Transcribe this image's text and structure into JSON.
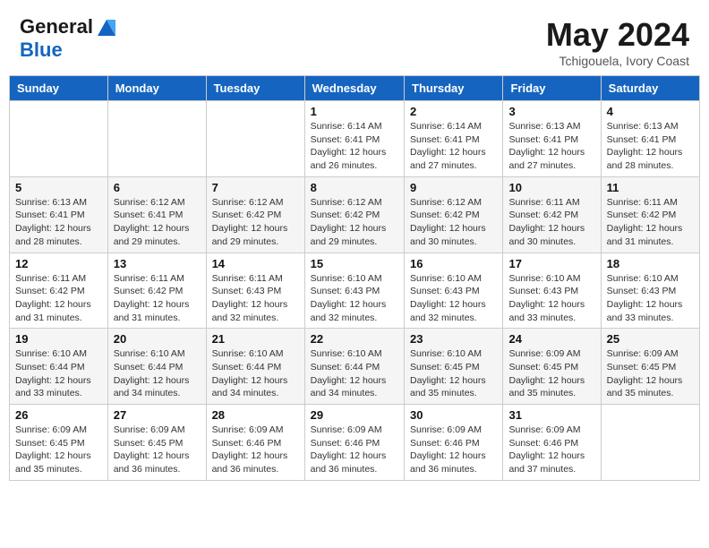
{
  "logo": {
    "line1": "General",
    "line2": "Blue"
  },
  "header": {
    "month": "May 2024",
    "location": "Tchigouela, Ivory Coast"
  },
  "weekdays": [
    "Sunday",
    "Monday",
    "Tuesday",
    "Wednesday",
    "Thursday",
    "Friday",
    "Saturday"
  ],
  "weeks": [
    [
      {
        "day": "",
        "info": ""
      },
      {
        "day": "",
        "info": ""
      },
      {
        "day": "",
        "info": ""
      },
      {
        "day": "1",
        "info": "Sunrise: 6:14 AM\nSunset: 6:41 PM\nDaylight: 12 hours\nand 26 minutes."
      },
      {
        "day": "2",
        "info": "Sunrise: 6:14 AM\nSunset: 6:41 PM\nDaylight: 12 hours\nand 27 minutes."
      },
      {
        "day": "3",
        "info": "Sunrise: 6:13 AM\nSunset: 6:41 PM\nDaylight: 12 hours\nand 27 minutes."
      },
      {
        "day": "4",
        "info": "Sunrise: 6:13 AM\nSunset: 6:41 PM\nDaylight: 12 hours\nand 28 minutes."
      }
    ],
    [
      {
        "day": "5",
        "info": "Sunrise: 6:13 AM\nSunset: 6:41 PM\nDaylight: 12 hours\nand 28 minutes."
      },
      {
        "day": "6",
        "info": "Sunrise: 6:12 AM\nSunset: 6:41 PM\nDaylight: 12 hours\nand 29 minutes."
      },
      {
        "day": "7",
        "info": "Sunrise: 6:12 AM\nSunset: 6:42 PM\nDaylight: 12 hours\nand 29 minutes."
      },
      {
        "day": "8",
        "info": "Sunrise: 6:12 AM\nSunset: 6:42 PM\nDaylight: 12 hours\nand 29 minutes."
      },
      {
        "day": "9",
        "info": "Sunrise: 6:12 AM\nSunset: 6:42 PM\nDaylight: 12 hours\nand 30 minutes."
      },
      {
        "day": "10",
        "info": "Sunrise: 6:11 AM\nSunset: 6:42 PM\nDaylight: 12 hours\nand 30 minutes."
      },
      {
        "day": "11",
        "info": "Sunrise: 6:11 AM\nSunset: 6:42 PM\nDaylight: 12 hours\nand 31 minutes."
      }
    ],
    [
      {
        "day": "12",
        "info": "Sunrise: 6:11 AM\nSunset: 6:42 PM\nDaylight: 12 hours\nand 31 minutes."
      },
      {
        "day": "13",
        "info": "Sunrise: 6:11 AM\nSunset: 6:42 PM\nDaylight: 12 hours\nand 31 minutes."
      },
      {
        "day": "14",
        "info": "Sunrise: 6:11 AM\nSunset: 6:43 PM\nDaylight: 12 hours\nand 32 minutes."
      },
      {
        "day": "15",
        "info": "Sunrise: 6:10 AM\nSunset: 6:43 PM\nDaylight: 12 hours\nand 32 minutes."
      },
      {
        "day": "16",
        "info": "Sunrise: 6:10 AM\nSunset: 6:43 PM\nDaylight: 12 hours\nand 32 minutes."
      },
      {
        "day": "17",
        "info": "Sunrise: 6:10 AM\nSunset: 6:43 PM\nDaylight: 12 hours\nand 33 minutes."
      },
      {
        "day": "18",
        "info": "Sunrise: 6:10 AM\nSunset: 6:43 PM\nDaylight: 12 hours\nand 33 minutes."
      }
    ],
    [
      {
        "day": "19",
        "info": "Sunrise: 6:10 AM\nSunset: 6:44 PM\nDaylight: 12 hours\nand 33 minutes."
      },
      {
        "day": "20",
        "info": "Sunrise: 6:10 AM\nSunset: 6:44 PM\nDaylight: 12 hours\nand 34 minutes."
      },
      {
        "day": "21",
        "info": "Sunrise: 6:10 AM\nSunset: 6:44 PM\nDaylight: 12 hours\nand 34 minutes."
      },
      {
        "day": "22",
        "info": "Sunrise: 6:10 AM\nSunset: 6:44 PM\nDaylight: 12 hours\nand 34 minutes."
      },
      {
        "day": "23",
        "info": "Sunrise: 6:10 AM\nSunset: 6:45 PM\nDaylight: 12 hours\nand 35 minutes."
      },
      {
        "day": "24",
        "info": "Sunrise: 6:09 AM\nSunset: 6:45 PM\nDaylight: 12 hours\nand 35 minutes."
      },
      {
        "day": "25",
        "info": "Sunrise: 6:09 AM\nSunset: 6:45 PM\nDaylight: 12 hours\nand 35 minutes."
      }
    ],
    [
      {
        "day": "26",
        "info": "Sunrise: 6:09 AM\nSunset: 6:45 PM\nDaylight: 12 hours\nand 35 minutes."
      },
      {
        "day": "27",
        "info": "Sunrise: 6:09 AM\nSunset: 6:45 PM\nDaylight: 12 hours\nand 36 minutes."
      },
      {
        "day": "28",
        "info": "Sunrise: 6:09 AM\nSunset: 6:46 PM\nDaylight: 12 hours\nand 36 minutes."
      },
      {
        "day": "29",
        "info": "Sunrise: 6:09 AM\nSunset: 6:46 PM\nDaylight: 12 hours\nand 36 minutes."
      },
      {
        "day": "30",
        "info": "Sunrise: 6:09 AM\nSunset: 6:46 PM\nDaylight: 12 hours\nand 36 minutes."
      },
      {
        "day": "31",
        "info": "Sunrise: 6:09 AM\nSunset: 6:46 PM\nDaylight: 12 hours\nand 37 minutes."
      },
      {
        "day": "",
        "info": ""
      }
    ]
  ]
}
